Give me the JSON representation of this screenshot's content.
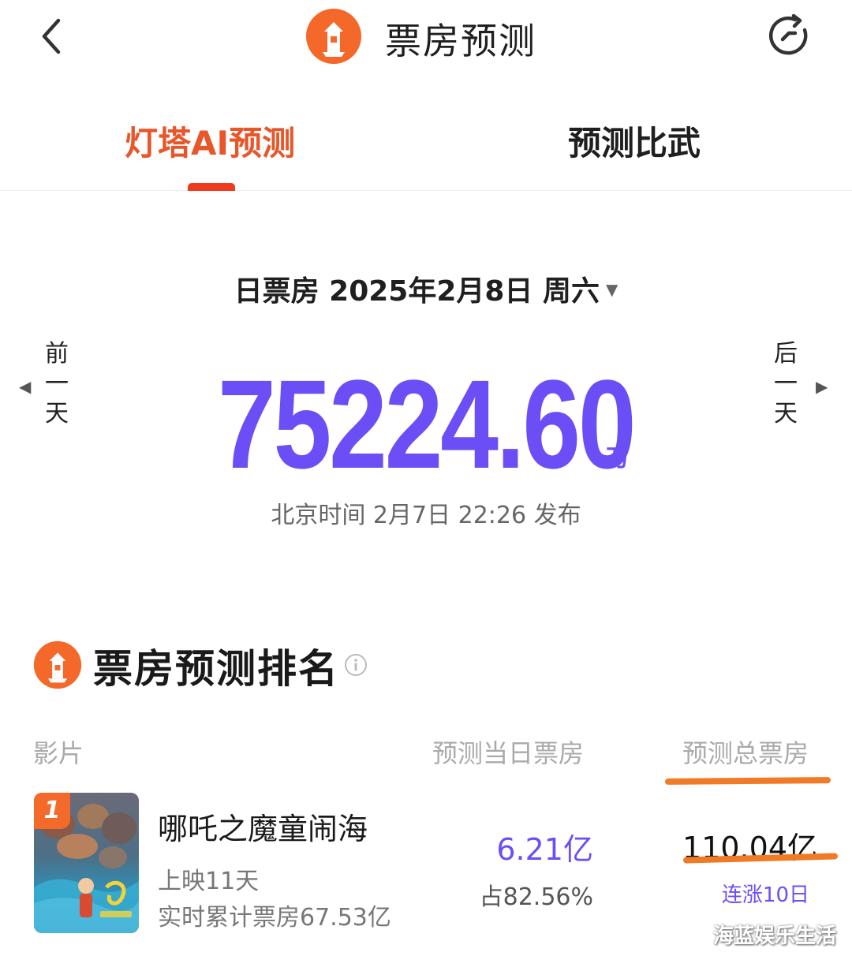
{
  "nav": {
    "back_icon": "chevron-left-icon",
    "logo_icon": "lighthouse-logo-icon",
    "title": "票房预测",
    "refresh_icon": "refresh-icon"
  },
  "tabs": [
    {
      "label": "灯塔AI预测",
      "active": true
    },
    {
      "label": "预测比武",
      "active": false
    }
  ],
  "accent_color": "#e8562a",
  "value_color": "#6b4ef5",
  "forecast": {
    "date_label": "日票房 2025年2月8日 周六",
    "date_caret": "▼",
    "prev_day": {
      "chars": [
        "前",
        "一",
        "天"
      ],
      "arrow": "◀"
    },
    "next_day": {
      "chars": [
        "后",
        "一",
        "天"
      ],
      "arrow": "▶"
    },
    "amount": "75224.60",
    "unit": "万",
    "published": "北京时间 2月7日 22:26 发布"
  },
  "ranking": {
    "title": "票房预测排名",
    "info_icon": "info-icon",
    "columns": {
      "film": "影片",
      "day": "预测当日票房",
      "total": "预测总票房"
    },
    "rows": [
      {
        "rank": "1",
        "name": "哪吒之魔童闹海",
        "days_showing": "上映11天",
        "cumulative": "实时累计票房67.53亿",
        "day_forecast": "6.21亿",
        "day_share": "占82.56%",
        "total_forecast": "110.04亿",
        "trend": "连涨10日"
      }
    ]
  },
  "watermark": "海蓝娱乐生活"
}
